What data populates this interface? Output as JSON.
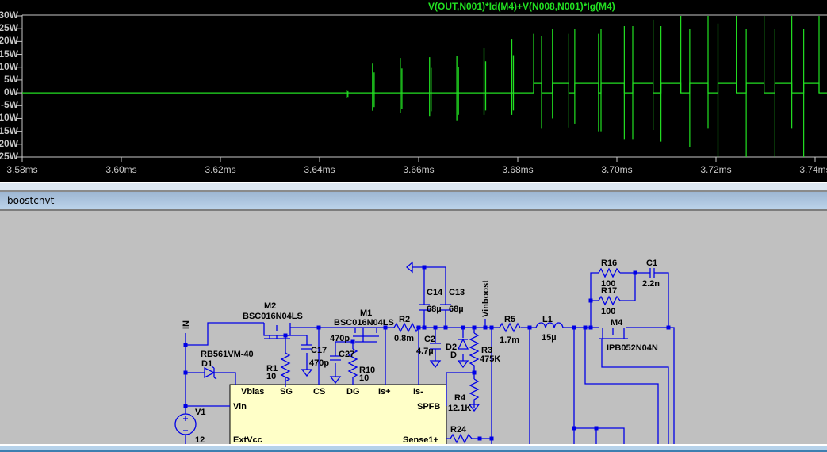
{
  "waveform": {
    "trace_label": "V(OUT,N001)*Id(M4)+V(N008,N001)*Ig(M4)",
    "trace_color": "#22e022",
    "background": "#000000"
  },
  "chart_data": {
    "type": "line",
    "title": "V(OUT,N001)*Id(M4)+V(N008,N001)*Ig(M4)",
    "xlabel": "",
    "ylabel": "",
    "x_unit": "ms",
    "y_unit": "W",
    "xlim": [
      3.58,
      3.745
    ],
    "ylim": [
      -25,
      30
    ],
    "x_ticks": [
      "3.58ms",
      "3.60ms",
      "3.62ms",
      "3.64ms",
      "3.66ms",
      "3.68ms",
      "3.70ms",
      "3.72ms",
      "3.74ms"
    ],
    "x_tick_values": [
      3.58,
      3.6,
      3.62,
      3.64,
      3.66,
      3.68,
      3.7,
      3.72,
      3.74
    ],
    "y_ticks": [
      "30W",
      "25W",
      "20W",
      "15W",
      "10W",
      "5W",
      "0W",
      "-5W",
      "-10W",
      "-15W",
      "-20W",
      "-25W"
    ],
    "y_tick_values": [
      30,
      25,
      20,
      15,
      10,
      5,
      0,
      -5,
      -10,
      -15,
      -20,
      -25
    ],
    "grid": false,
    "baseline_W": 0,
    "plateau_W": 3.7,
    "bursts": [
      {
        "t": 3.6454,
        "max": 1,
        "min": -2
      },
      {
        "t": 3.6507,
        "max": 11.4,
        "min": -7
      },
      {
        "t": 3.6563,
        "max": 13.6,
        "min": -7.7
      },
      {
        "t": 3.6622,
        "max": 13.9,
        "min": -9
      },
      {
        "t": 3.6677,
        "max": 14.5,
        "min": -10.7
      },
      {
        "t": 3.6732,
        "max": 17.6,
        "min": -8.6
      },
      {
        "t": 3.6788,
        "max": 21,
        "min": -8.6
      }
    ],
    "transitions": [
      {
        "t": 3.6832,
        "to": "plateau",
        "max": 23,
        "min": 0
      },
      {
        "t": 3.6848,
        "to": "zero",
        "max": 22,
        "min": -14
      },
      {
        "t": 3.687,
        "to": "plateau",
        "max": 25,
        "min": -10
      },
      {
        "t": 3.6903,
        "to": "zero",
        "max": 23,
        "min": -13.5
      },
      {
        "t": 3.6915,
        "to": "plateau",
        "max": 25,
        "min": -12
      },
      {
        "t": 3.6963,
        "to": "zero",
        "max": 23,
        "min": -15
      },
      {
        "t": 3.6968,
        "to": "plateau",
        "max": 25,
        "min": -15
      },
      {
        "t": 3.7015,
        "to": "zero",
        "max": 26,
        "min": -18
      },
      {
        "t": 3.7032,
        "to": "plateau",
        "max": 26,
        "min": -18
      },
      {
        "t": 3.7073,
        "to": "zero",
        "max": 28.5,
        "min": -14.5
      },
      {
        "t": 3.7089,
        "to": "plateau",
        "max": 26,
        "min": -19
      },
      {
        "t": 3.7129,
        "to": "zero",
        "max": 30,
        "min": 0
      },
      {
        "t": 3.7147,
        "to": "plateau",
        "max": 25,
        "min": -21
      },
      {
        "t": 3.7184,
        "to": "zero",
        "max": 30,
        "min": -14
      },
      {
        "t": 3.7204,
        "to": "plateau",
        "max": 27,
        "min": -25
      },
      {
        "t": 3.7241,
        "to": "zero",
        "max": 30,
        "min": 0
      },
      {
        "t": 3.7261,
        "to": "plateau",
        "max": 25,
        "min": -25
      },
      {
        "t": 3.7297,
        "to": "zero",
        "max": 30,
        "min": 0
      },
      {
        "t": 3.7319,
        "to": "plateau",
        "max": 25,
        "min": -25
      },
      {
        "t": 3.7353,
        "to": "zero",
        "max": 30,
        "min": -14
      },
      {
        "t": 3.7377,
        "to": "plateau",
        "max": 25,
        "min": -25
      },
      {
        "t": 3.7408,
        "to": "zero",
        "max": 30,
        "min": 0
      }
    ]
  },
  "schematic_window": {
    "tab_title": "boostcnvt",
    "background": "#c0c0c0",
    "wire_color": "#0000e6",
    "nets": {
      "in": "IN",
      "vinboost": "Vinboost"
    },
    "components": {
      "v1": {
        "name": "V1",
        "value": "12"
      },
      "d1": {
        "name": "D1",
        "value": "RB561VM-40"
      },
      "m2": {
        "name": "M2",
        "value": "BSC016N04LS"
      },
      "m1": {
        "name": "M1",
        "value": "BSC016N04LS",
        "extra": "470p"
      },
      "r1": {
        "name": "R1",
        "value": "10"
      },
      "c17": {
        "name": "C17",
        "value": "470p"
      },
      "c27": {
        "name": "C27"
      },
      "r10": {
        "name": "R10",
        "value": "10"
      },
      "r2": {
        "name": "R2",
        "value": "0.8m"
      },
      "c14": {
        "name": "C14",
        "value": "68µ"
      },
      "c13": {
        "name": "C13",
        "value": "68µ"
      },
      "c2": {
        "name": "C2",
        "value": "4.7µ"
      },
      "d2": {
        "name": "D2",
        "value": "D"
      },
      "r3": {
        "name": "R3",
        "value": "475K"
      },
      "r4": {
        "name": "R4",
        "value": "12.1K"
      },
      "r5": {
        "name": "R5",
        "value": "1.7m"
      },
      "l1": {
        "name": "L1",
        "value": "15µ"
      },
      "r16": {
        "name": "R16",
        "value": "100"
      },
      "r17": {
        "name": "R17",
        "value": "100"
      },
      "c1": {
        "name": "C1",
        "value": "2.2n"
      },
      "m4": {
        "name": "M4",
        "value": "IPB052N04N"
      },
      "r24": {
        "name": "R24"
      }
    },
    "controller_pins": [
      "Vbias",
      "SG",
      "CS",
      "DG",
      "Is+",
      "Is-",
      "Vin",
      "SPFB",
      "ExtVcc",
      "Sense1+"
    ],
    "controller_fill": "#ffffc8"
  }
}
